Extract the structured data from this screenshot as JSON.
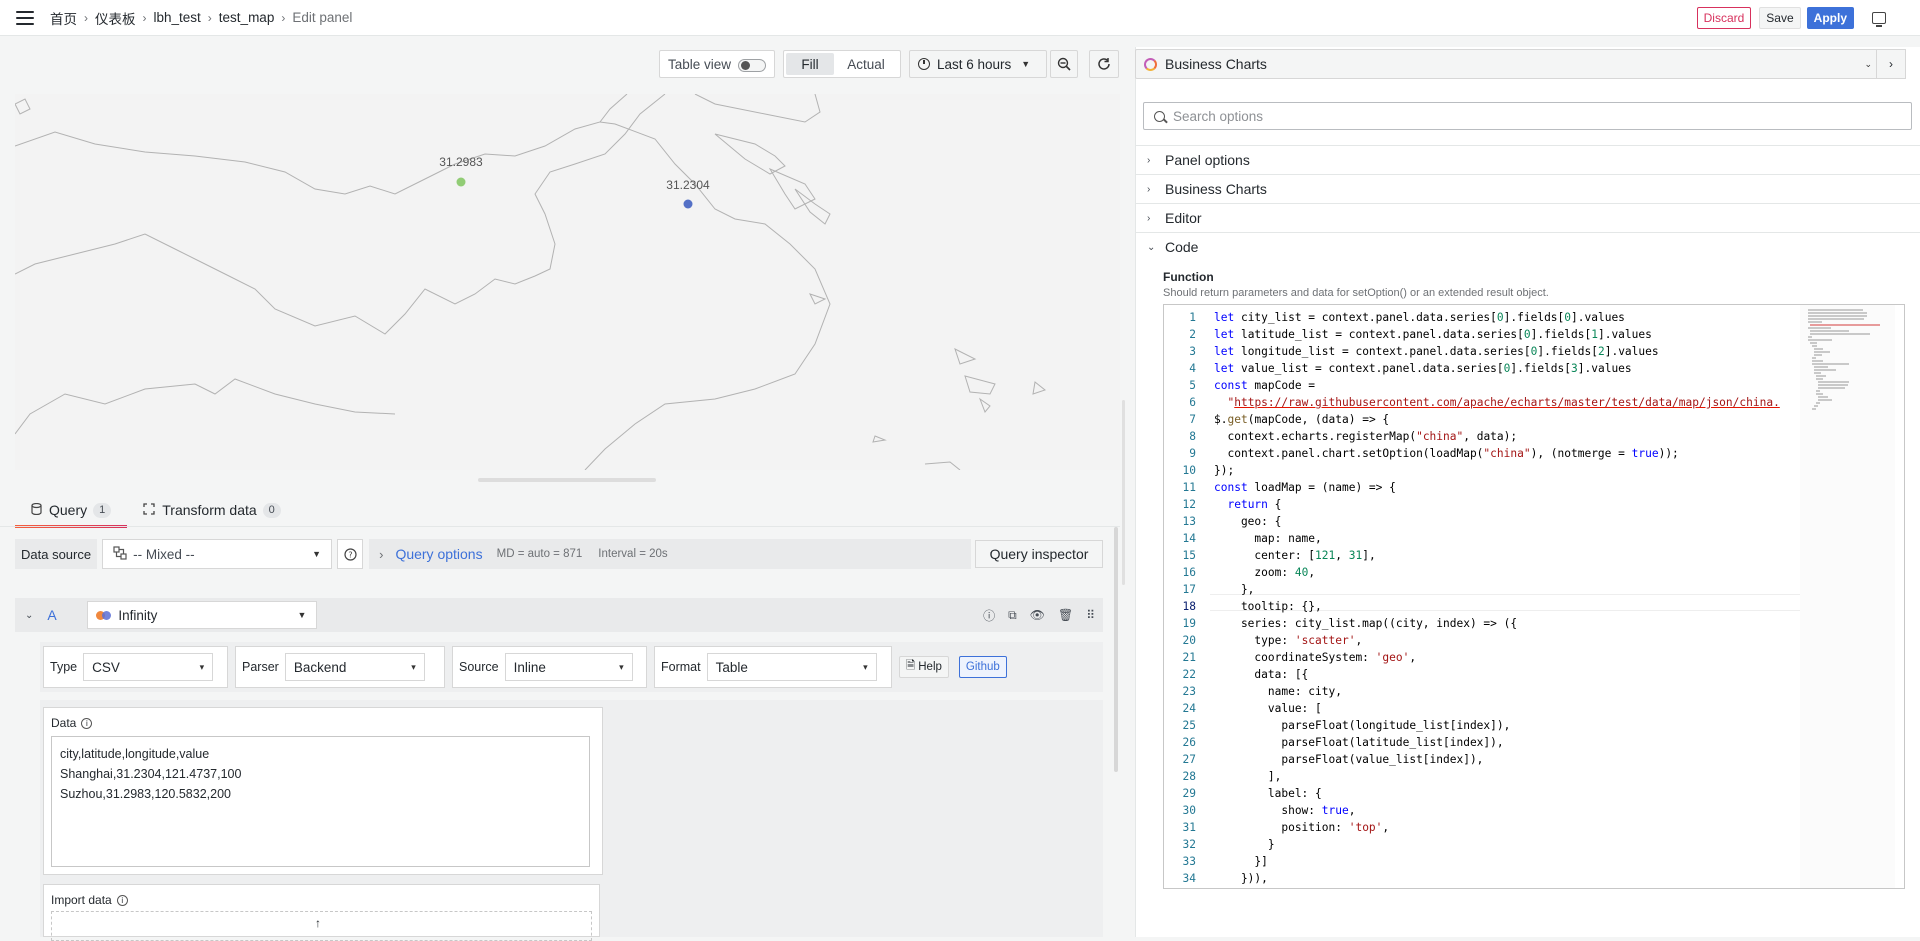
{
  "breadcrumbs": [
    "首页",
    "仪表板",
    "lbh_test",
    "test_map",
    "Edit panel"
  ],
  "actions": {
    "discard": "Discard",
    "save": "Save",
    "apply": "Apply"
  },
  "toolbar": {
    "table_view": "Table view",
    "fill": "Fill",
    "actual": "Actual",
    "time_range": "Last 6 hours"
  },
  "map": {
    "labels": [
      {
        "text": "31.2983",
        "color": "#91cc75"
      },
      {
        "text": "31.2304",
        "color": "#5470c6"
      }
    ]
  },
  "query_tabs": [
    {
      "label": "Query",
      "count": "1"
    },
    {
      "label": "Transform data",
      "count": "0"
    }
  ],
  "datasource": {
    "label": "Data source",
    "value": "-- Mixed --",
    "query_options": "Query options",
    "md": "MD = auto = 871",
    "interval": "Interval = 20s",
    "inspector": "Query inspector"
  },
  "query": {
    "ref": "A",
    "source": "Infinity",
    "fields": [
      {
        "label": "Type",
        "value": "CSV"
      },
      {
        "label": "Parser",
        "value": "Backend"
      },
      {
        "label": "Source",
        "value": "Inline"
      },
      {
        "label": "Format",
        "value": "Table"
      }
    ],
    "help": "Help",
    "github": "Github",
    "data_label": "Data",
    "data_text": "city,latitude,longitude,value\nShanghai,31.2304,121.4737,100\nSuzhou,31.2983,120.5832,200",
    "import_label": "Import data"
  },
  "right": {
    "viz": "Business Charts",
    "search_placeholder": "Search options",
    "sections": [
      "Panel options",
      "Business Charts",
      "Editor",
      "Code"
    ],
    "function_label": "Function",
    "function_desc": "Should return parameters and data for setOption() or an extended result object."
  },
  "code_lines": [
    "let city_list = context.panel.data.series[0].fields[0].values",
    "let latitude_list = context.panel.data.series[0].fields[1].values",
    "let longitude_list = context.panel.data.series[0].fields[2].values",
    "let value_list = context.panel.data.series[0].fields[3].values",
    "const mapCode =",
    "  \"https://raw.githubusercontent.com/apache/echarts/master/test/data/map/json/china.",
    "$.get(mapCode, (data) => {",
    "  context.echarts.registerMap(\"china\", data);",
    "  context.panel.chart.setOption(loadMap(\"china\"), (notmerge = true));",
    "});",
    "const loadMap = (name) => {",
    "  return {",
    "    geo: {",
    "      map: name,",
    "      center: [121, 31],",
    "      zoom: 40,",
    "    },",
    "    tooltip: {},",
    "    series: city_list.map((city, index) => ({",
    "      type: 'scatter',",
    "      coordinateSystem: 'geo',",
    "      data: [{",
    "        name: city,",
    "        value: [",
    "          parseFloat(longitude_list[index]),",
    "          parseFloat(latitude_list[index]),",
    "          parseFloat(value_list[index]),",
    "        ],",
    "        label: {",
    "          show: true,",
    "          position: 'top',",
    "        }",
    "      }]",
    "    })),"
  ]
}
